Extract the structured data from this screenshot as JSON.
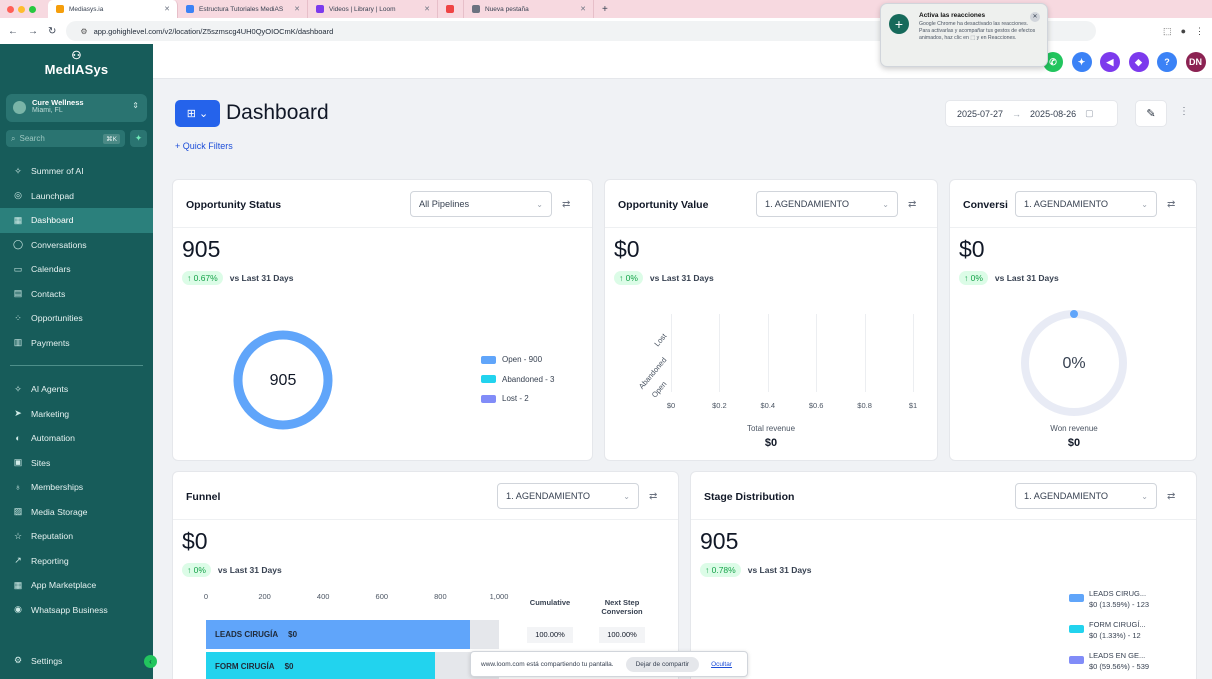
{
  "browser": {
    "tabs": [
      {
        "label": "Mediasys.ia",
        "color": "#f59e0b",
        "active": true
      },
      {
        "label": "Estructura Tutoriales MediAS",
        "color": "#3b82f6",
        "active": false
      },
      {
        "label": "Videos | Library | Loom",
        "color": "#7c3aed",
        "active": false
      },
      {
        "label": "",
        "color": "#ef4444",
        "active": false
      },
      {
        "label": "Nueva pestaña",
        "color": "#6b7280",
        "active": false
      }
    ],
    "url": "app.gohighlevel.com/v2/location/Z5szmscg4UH0QyOIOCmK/dashboard"
  },
  "popup": {
    "title": "Activa las reacciones",
    "body": "Google Chrome ha desactivado las reacciones. Para activarlas y acompañar tus gestos de efectos animados, haz clic en ⬚ y en Reacciones."
  },
  "sidebar": {
    "brand": "MedIASys",
    "location_name": "Cure Wellness",
    "location_city": "Miami, FL",
    "search_placeholder": "Search",
    "search_shortcut": "⌘K",
    "items_top": [
      {
        "label": "Summer of AI",
        "icon": "sparkle-icon",
        "glyph": "✧"
      },
      {
        "label": "Launchpad",
        "icon": "rocket-icon",
        "glyph": "◎"
      },
      {
        "label": "Dashboard",
        "icon": "dashboard-icon",
        "glyph": "▦",
        "active": true
      },
      {
        "label": "Conversations",
        "icon": "chat-icon",
        "glyph": "◯"
      },
      {
        "label": "Calendars",
        "icon": "calendar-icon",
        "glyph": "▭"
      },
      {
        "label": "Contacts",
        "icon": "contacts-icon",
        "glyph": "▤"
      },
      {
        "label": "Opportunities",
        "icon": "opportunities-icon",
        "glyph": "⁘"
      },
      {
        "label": "Payments",
        "icon": "payments-icon",
        "glyph": "▥"
      }
    ],
    "items_bottom": [
      {
        "label": "AI Agents",
        "icon": "ai-agents-icon",
        "glyph": "✧"
      },
      {
        "label": "Marketing",
        "icon": "send-icon",
        "glyph": "➤"
      },
      {
        "label": "Automation",
        "icon": "automation-icon",
        "glyph": "◐"
      },
      {
        "label": "Sites",
        "icon": "sites-icon",
        "glyph": "▣"
      },
      {
        "label": "Memberships",
        "icon": "memberships-icon",
        "glyph": "♁"
      },
      {
        "label": "Media Storage",
        "icon": "media-icon",
        "glyph": "▨"
      },
      {
        "label": "Reputation",
        "icon": "star-icon",
        "glyph": "☆"
      },
      {
        "label": "Reporting",
        "icon": "reporting-icon",
        "glyph": "↗"
      },
      {
        "label": "App Marketplace",
        "icon": "marketplace-icon",
        "glyph": "▦"
      },
      {
        "label": "Whatsapp Business",
        "icon": "whatsapp-icon",
        "glyph": "◉"
      }
    ],
    "settings_label": "Settings"
  },
  "topbar": {
    "icons": [
      {
        "name": "phone-icon",
        "glyph": "✆",
        "color": "#22c55e"
      },
      {
        "name": "magic-icon",
        "glyph": "✦",
        "color": "#3b82f6"
      },
      {
        "name": "megaphone-icon",
        "glyph": "◀",
        "color": "#7c3aed"
      },
      {
        "name": "bell-icon",
        "glyph": "◆",
        "color": "#7c3aed"
      },
      {
        "name": "help-icon",
        "glyph": "?",
        "color": "#3b82f6"
      },
      {
        "name": "user-avatar",
        "glyph": "DN",
        "color": "#8b2252"
      }
    ]
  },
  "header": {
    "title": "Dashboard",
    "quick_filters": "+ Quick Filters",
    "date_start": "2025-07-27",
    "date_end": "2025-08-26"
  },
  "cards": {
    "status": {
      "title": "Opportunity Status",
      "dropdown": "All Pipelines",
      "value": "905",
      "change": "↑ 0.67%",
      "compare": "vs Last 31 Days",
      "donut_center": "905",
      "legend": [
        {
          "label": "Open - 900",
          "color": "#60a5fa"
        },
        {
          "label": "Abandoned - 3",
          "color": "#22d3ee"
        },
        {
          "label": "Lost - 2",
          "color": "#818cf8"
        }
      ]
    },
    "value": {
      "title": "Opportunity Value",
      "dropdown": "1. AGENDAMIENTO",
      "value": "$0",
      "change": "↑ 0%",
      "compare": "vs Last 31 Days",
      "y_labels": [
        "Lost",
        "Abandoned",
        "Open"
      ],
      "x_labels": [
        "$0",
        "$0.2",
        "$0.4",
        "$0.6",
        "$0.8",
        "$1"
      ],
      "total_label": "Total revenue",
      "total_value": "$0"
    },
    "conversion": {
      "title": "Conversi",
      "dropdown": "1. AGENDAMIENTO",
      "value": "$0",
      "change": "↑ 0%",
      "compare": "vs Last 31 Days",
      "gauge_center": "0%",
      "won_label": "Won revenue",
      "won_value": "$0"
    },
    "funnel": {
      "title": "Funnel",
      "dropdown": "1. AGENDAMIENTO",
      "value": "$0",
      "change": "↑ 0%",
      "compare": "vs Last 31 Days",
      "axis": [
        "0",
        "200",
        "400",
        "600",
        "800",
        "1,000"
      ],
      "col_cumulative": "Cumulative",
      "col_next": "Next Step Conversion",
      "rows": [
        {
          "label": "LEADS CIRUGÍA",
          "amount": "$0",
          "count": 900,
          "color": "#60a5fa",
          "cumulative": "100.00%",
          "next": "100.00%"
        },
        {
          "label": "FORM CIRUGÍA",
          "amount": "$0",
          "count": 780,
          "color": "#22d3ee",
          "cumulative": "",
          "next": ""
        }
      ]
    },
    "stage": {
      "title": "Stage Distribution",
      "dropdown": "1. AGENDAMIENTO",
      "value": "905",
      "change": "↑ 0.78%",
      "compare": "vs Last 31 Days",
      "legend": [
        {
          "name": "LEADS CIRUG...",
          "detail": "$0 (13.59%) - 123",
          "color": "#60a5fa"
        },
        {
          "name": "FORM CIRUGÍ...",
          "detail": "$0 (1.33%) - 12",
          "color": "#22d3ee"
        },
        {
          "name": "LEADS EN GE...",
          "detail": "$0 (59.56%) - 539",
          "color": "#818cf8"
        }
      ]
    }
  },
  "loom_bar": {
    "message": "www.loom.com está compartiendo tu pantalla.",
    "stop": "Dejar de compartir",
    "hide": "Ocultar"
  }
}
